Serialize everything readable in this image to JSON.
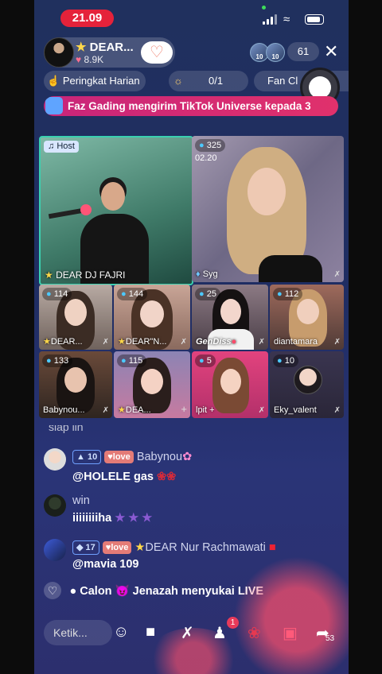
{
  "status": {
    "time": "21.09"
  },
  "header": {
    "host_name": "DEAR...",
    "likes": "8.9K",
    "viewer_ranks": [
      "10",
      "10"
    ],
    "viewer_count": "61",
    "daily_ranking": "Peringkat Harian",
    "goal_progress": "0/1",
    "fan_club": "Fan Cl"
  },
  "banner": {
    "text": "Faz Gading mengirim TikTok Universe kepada 3"
  },
  "grid": {
    "host": {
      "tag": "Host",
      "name": "DEAR DJ FAJRI"
    },
    "big_guest": {
      "count": "325",
      "timer": "02.20",
      "name": "Syg"
    },
    "guests": [
      {
        "count": "114",
        "name": "DEAR..."
      },
      {
        "count": "144",
        "name": "DEAR\"N..."
      },
      {
        "count": "25",
        "name": "GenDiss"
      },
      {
        "count": "112",
        "name": "diantamara"
      },
      {
        "count": "133",
        "name": "Babynou..."
      },
      {
        "count": "115",
        "name": "DEA..."
      },
      {
        "count": "5",
        "name": "lpit"
      },
      {
        "count": "10",
        "name": "Eky_valent"
      }
    ]
  },
  "chat": {
    "faded": "siap lin",
    "messages": [
      {
        "level": "10",
        "badge": "love",
        "user": "Babynou",
        "text": "@HOLELE gas"
      },
      {
        "user": "win",
        "text": "iiiiiiiiha"
      },
      {
        "level": "17",
        "badge": "love",
        "user": "DEAR Nur Rachmawati",
        "text": "@mavia 109"
      }
    ],
    "like": {
      "user": "Calon 😈 Jenazah",
      "text": "menyukai LIVE"
    }
  },
  "toolbar": {
    "comment_placeholder": "Ketik...",
    "guests_badge": "1",
    "share_count": "53"
  }
}
